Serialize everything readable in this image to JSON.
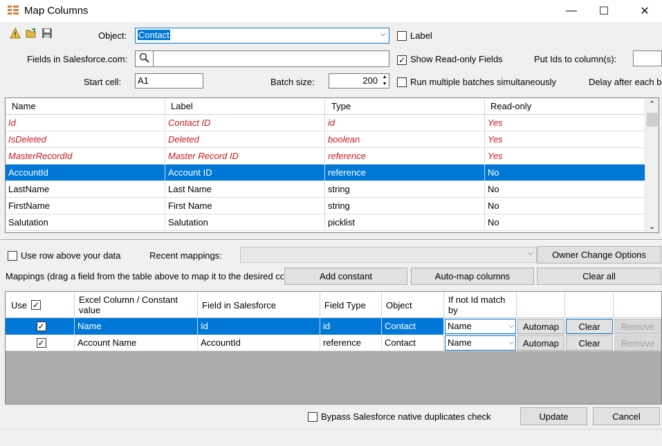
{
  "window": {
    "title": "Map Columns",
    "minimize": "—",
    "maximize": "☐",
    "close": "✕"
  },
  "toolbar": {
    "icons": [
      "warning-icon",
      "open-folder-icon",
      "save-icon"
    ]
  },
  "form": {
    "object_label": "Object:",
    "object_value": "Contact",
    "label_checkbox": "Label",
    "fields_label": "Fields in Salesforce.com:",
    "fields_search_value": "",
    "show_readonly_label": "Show Read-only Fields",
    "show_readonly_checked": true,
    "put_ids_label": "Put Ids to column(s):",
    "start_cell_label": "Start cell:",
    "start_cell_value": "A1",
    "batch_size_label": "Batch size:",
    "batch_size_value": "200",
    "run_multiple_label": "Run multiple batches simultaneously",
    "delay_label": "Delay after each ba"
  },
  "fields_table": {
    "columns": [
      "Name",
      "Label",
      "Type",
      "Read-only"
    ],
    "rows": [
      {
        "name": "Id",
        "label": "Contact ID",
        "type": "id",
        "readonly": "Yes"
      },
      {
        "name": "IsDeleted",
        "label": "Deleted",
        "type": "boolean",
        "readonly": "Yes"
      },
      {
        "name": "MasterRecordId",
        "label": "Master Record ID",
        "type": "reference",
        "readonly": "Yes"
      },
      {
        "name": "AccountId",
        "label": "Account ID",
        "type": "reference",
        "readonly": "No"
      },
      {
        "name": "LastName",
        "label": "Last Name",
        "type": "string",
        "readonly": "No"
      },
      {
        "name": "FirstName",
        "label": "First Name",
        "type": "string",
        "readonly": "No"
      },
      {
        "name": "Salutation",
        "label": "Salutation",
        "type": "picklist",
        "readonly": "No"
      }
    ]
  },
  "mapping_controls": {
    "use_row_above_label": "Use row above your data",
    "recent_mappings_label": "Recent mappings:",
    "recent_mappings_value": "",
    "owner_change_button": "Owner Change Options",
    "mappings_hint": "Mappings (drag a field from the table above to map it to the desired co",
    "add_constant_button": "Add constant",
    "auto_map_button": "Auto-map columns",
    "clear_all_button": "Clear all"
  },
  "mappings_table": {
    "columns": {
      "use": "Use",
      "excel": "Excel Column / Constant value",
      "field": "Field in Salesforce",
      "field_type": "Field Type",
      "object": "Object",
      "if_not_match": "If not Id match by"
    },
    "rows": [
      {
        "use": true,
        "excel": "Name",
        "field": "Id",
        "field_type": "id",
        "object": "Contact",
        "match_by": "Name",
        "automap": "Automap",
        "clear": "Clear",
        "remove": "Remove"
      },
      {
        "use": true,
        "excel": "Account Name",
        "field": "AccountId",
        "field_type": "reference",
        "object": "Contact",
        "match_by": "Name",
        "automap": "Automap",
        "clear": "Clear",
        "remove": "Remove"
      }
    ]
  },
  "footer": {
    "bypass_label": "Bypass Salesforce native duplicates check",
    "update_button": "Update",
    "cancel_button": "Cancel"
  },
  "colors": {
    "selection": "#0078d7",
    "readonly_text": "#c8191e"
  }
}
